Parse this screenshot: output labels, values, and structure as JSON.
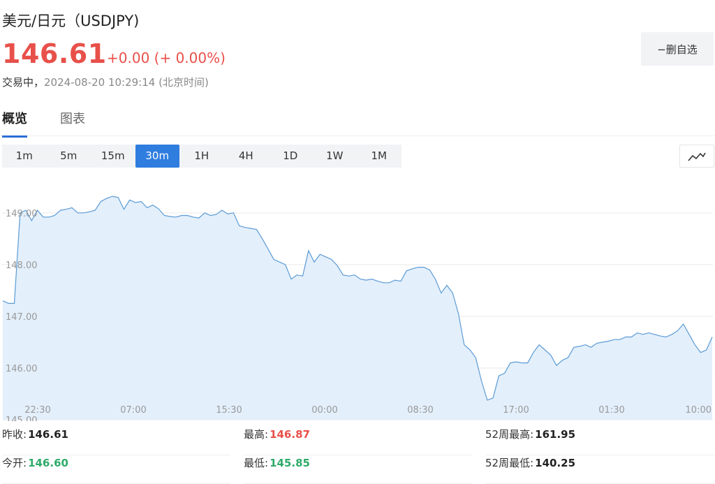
{
  "header": {
    "title": "美元/日元（USDJPY)",
    "price": "146.61",
    "change": "+0.00 (+ 0.00%)",
    "status_label": "交易中，",
    "timestamp": "2024-08-20 10:29:14",
    "timezone": "(北京时间)",
    "watchlist_button": "−删自选"
  },
  "tabs": [
    {
      "label": "概览",
      "active": true
    },
    {
      "label": "图表",
      "active": false
    }
  ],
  "timeframes": [
    "1m",
    "5m",
    "15m",
    "30m",
    "1H",
    "4H",
    "1D",
    "1W",
    "1M"
  ],
  "active_timeframe": "30m",
  "colors": {
    "up": "#e8504a",
    "down": "#2eab6a",
    "accent": "#2f7ddf",
    "line": "#5b9bd5",
    "fill": "#e3effb"
  },
  "chart_data": {
    "type": "area",
    "x_tick_labels": [
      "22:30",
      "07:00",
      "15:30",
      "00:00",
      "08:30",
      "17:00",
      "01:30",
      "10:00"
    ],
    "y_tick_labels": [
      "149.00",
      "148.00",
      "147.00",
      "146.00",
      "145.00"
    ],
    "ylim": [
      145.0,
      149.7
    ],
    "grid": true,
    "values": [
      147.3,
      147.25,
      147.25,
      149.0,
      149.05,
      148.85,
      149.05,
      148.92,
      148.92,
      148.95,
      149.05,
      149.07,
      149.1,
      149.0,
      149.0,
      149.02,
      149.05,
      149.22,
      149.28,
      149.32,
      149.3,
      149.07,
      149.25,
      149.2,
      149.22,
      149.1,
      149.15,
      149.08,
      148.95,
      148.93,
      148.92,
      148.95,
      148.95,
      148.92,
      148.9,
      149.0,
      148.95,
      148.97,
      149.05,
      148.98,
      149.0,
      148.75,
      148.72,
      148.7,
      148.68,
      148.5,
      148.3,
      148.1,
      148.05,
      148.0,
      147.72,
      147.8,
      147.78,
      148.27,
      148.05,
      148.2,
      148.15,
      148.1,
      147.98,
      147.8,
      147.78,
      147.8,
      147.72,
      147.7,
      147.72,
      147.68,
      147.65,
      147.65,
      147.7,
      147.68,
      147.88,
      147.92,
      147.95,
      147.95,
      147.9,
      147.72,
      147.45,
      147.6,
      147.45,
      147.05,
      146.45,
      146.35,
      146.2,
      145.75,
      145.38,
      145.42,
      145.85,
      145.9,
      146.1,
      146.12,
      146.1,
      146.1,
      146.3,
      146.45,
      146.35,
      146.25,
      146.05,
      146.15,
      146.2,
      146.4,
      146.42,
      146.45,
      146.4,
      146.48,
      146.5,
      146.52,
      146.55,
      146.55,
      146.6,
      146.6,
      146.68,
      146.65,
      146.68,
      146.65,
      146.62,
      146.6,
      146.65,
      146.72,
      146.85,
      146.65,
      146.45,
      146.3,
      146.35,
      146.6
    ]
  },
  "stats": [
    {
      "label": "昨收:",
      "value": "146.61",
      "color": "dark"
    },
    {
      "label": "最高:",
      "value": "146.87",
      "color": "red"
    },
    {
      "label": "52周最高:",
      "value": "161.95",
      "color": "dark"
    },
    {
      "label": "今开:",
      "value": "146.60",
      "color": "green"
    },
    {
      "label": "最低:",
      "value": "145.85",
      "color": "green"
    },
    {
      "label": "52周最低:",
      "value": "140.25",
      "color": "dark"
    }
  ]
}
